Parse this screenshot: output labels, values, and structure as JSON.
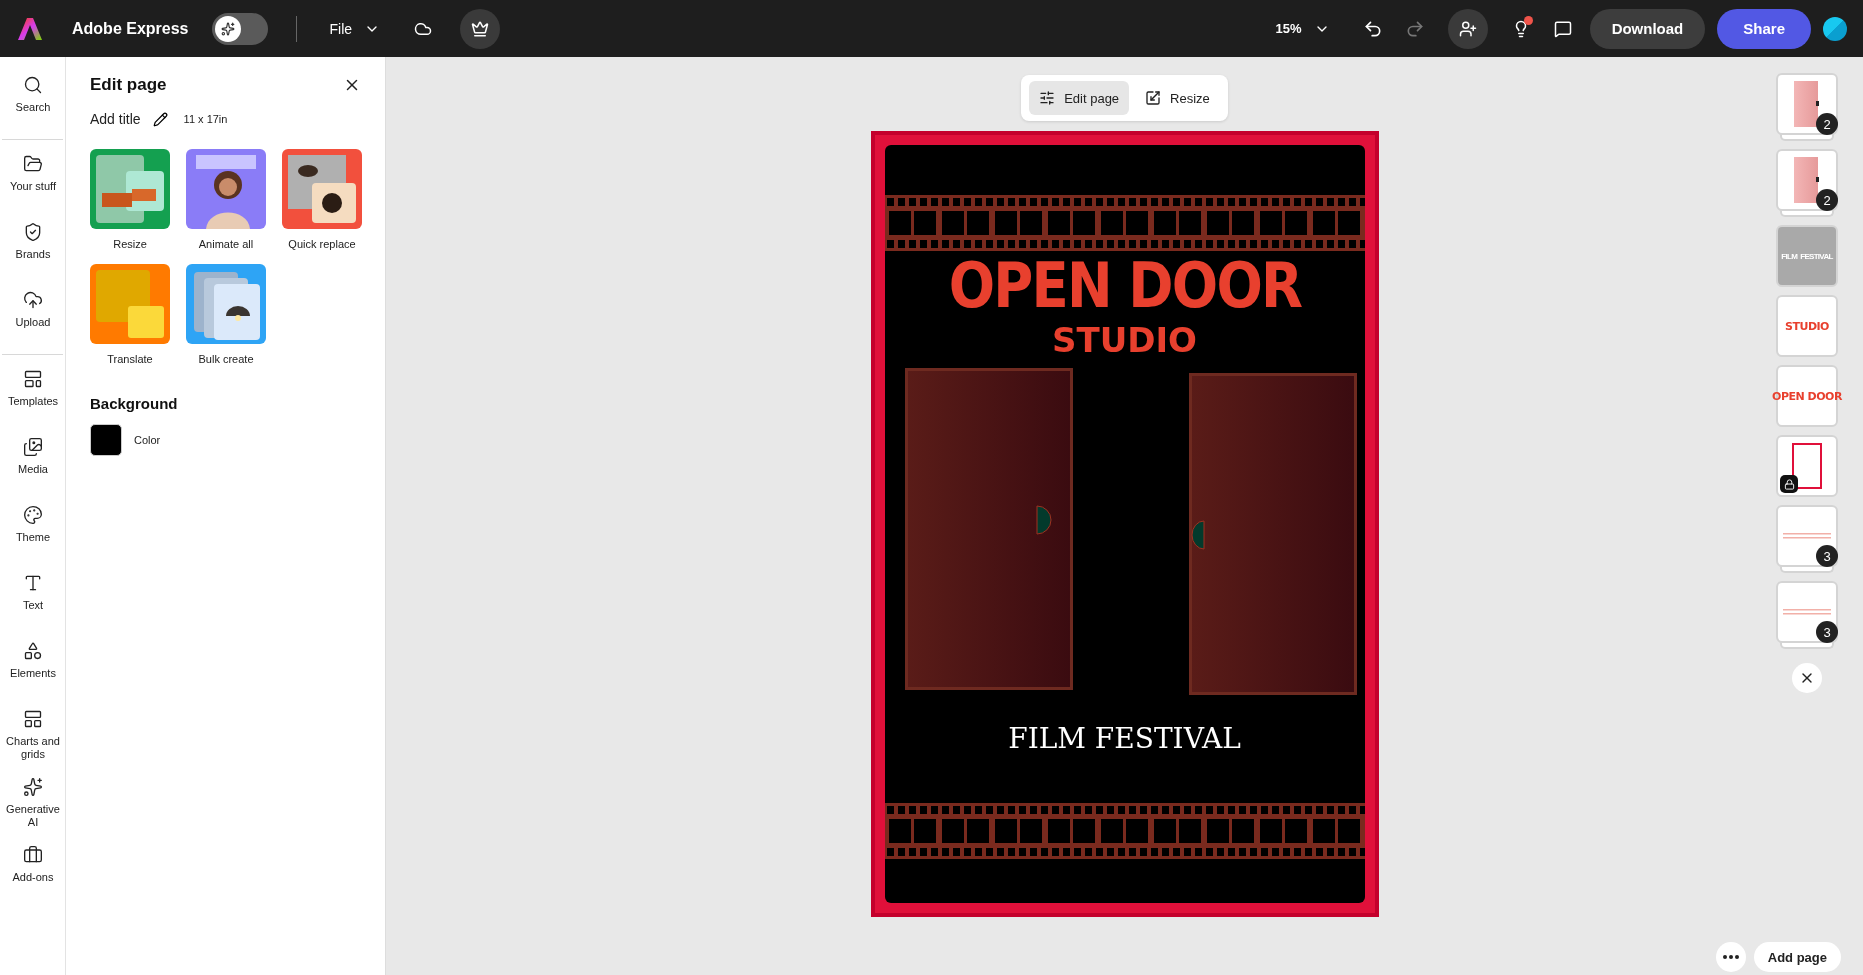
{
  "topbar": {
    "app_name": "Adobe Express",
    "ai_toggle": {
      "on": false
    },
    "file_menu": "File",
    "zoom": "15%",
    "undo": {
      "disabled": false
    },
    "redo": {
      "disabled": true
    },
    "download": "Download",
    "share": "Share"
  },
  "rail": {
    "groups": [
      [
        {
          "label": "Search",
          "selected": false
        }
      ],
      [
        {
          "label": "Your stuff",
          "selected": false
        },
        {
          "label": "Brands",
          "selected": false
        },
        {
          "label": "Upload",
          "selected": false
        }
      ],
      [
        {
          "label": "Templates",
          "selected": false
        },
        {
          "label": "Media",
          "selected": false
        },
        {
          "label": "Theme",
          "selected": false
        },
        {
          "label": "Text",
          "selected": false
        },
        {
          "label": "Elements",
          "selected": false
        },
        {
          "label": "Charts and grids",
          "selected": false
        },
        {
          "label": "Generative AI",
          "selected": false
        },
        {
          "label": "Add-ons",
          "selected": false
        }
      ]
    ]
  },
  "panel": {
    "title": "Edit page",
    "add_title": "Add title",
    "size": "11 x 17in",
    "actions": [
      {
        "label": "Resize",
        "kind": "picture"
      },
      {
        "label": "Animate all",
        "kind": "picture"
      },
      {
        "label": "Quick replace",
        "kind": "picture"
      },
      {
        "label": "Translate",
        "kind": "picture"
      },
      {
        "label": "Bulk create",
        "kind": "picture"
      }
    ],
    "background": {
      "heading": "Background",
      "color": "#000000",
      "label": "Color"
    }
  },
  "canvas": {
    "toolbar": [
      {
        "label": "Edit page",
        "selected": true
      },
      {
        "label": "Resize",
        "selected": false
      }
    ],
    "poster": {
      "title": "OPEN DOOR",
      "subtitle": "STUDIO",
      "tagline": "FILM FESTIVAL"
    },
    "layers": [
      {
        "kind": "door",
        "count": "2",
        "locked": false
      },
      {
        "kind": "door",
        "count": "2",
        "locked": false
      },
      {
        "kind": "text",
        "text": "FILM  FESTIVAL",
        "color": "#ffffff",
        "dimmed": true,
        "locked": false
      },
      {
        "kind": "text",
        "text": "STUDIO",
        "color": "#e8402e",
        "dimmed": false,
        "locked": false
      },
      {
        "kind": "text",
        "text": "OPEN DOOR",
        "color": "#e8402e",
        "dimmed": false,
        "locked": false
      },
      {
        "kind": "frame",
        "locked": true
      },
      {
        "kind": "strip",
        "count": "3",
        "locked": false
      },
      {
        "kind": "strip",
        "count": "3",
        "locked": false
      }
    ],
    "add_page": "Add page"
  }
}
